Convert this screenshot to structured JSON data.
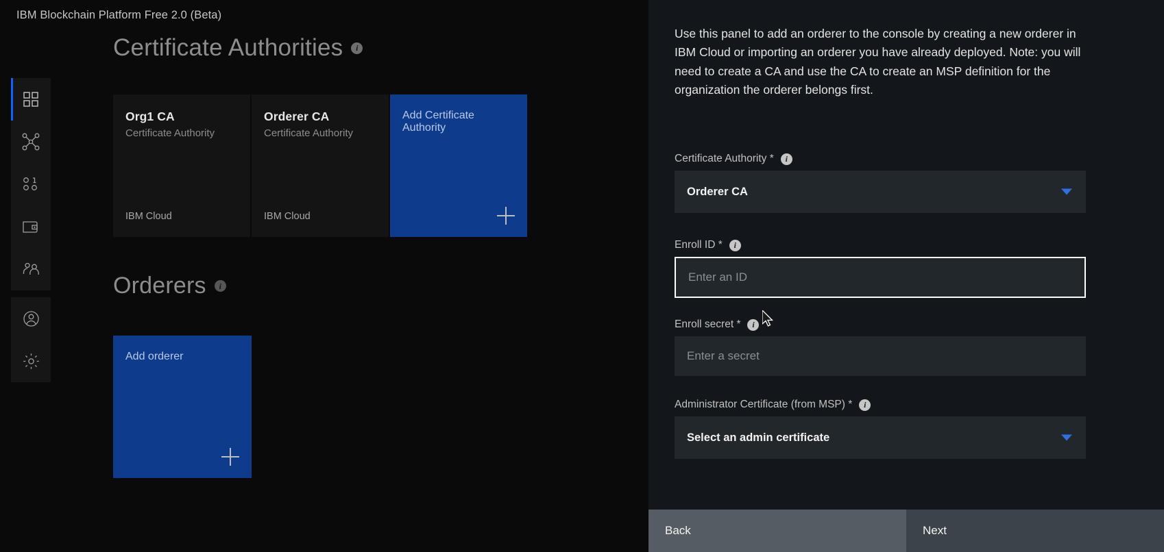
{
  "app": {
    "product_title": "IBM Blockchain Platform Free 2.0 (Beta)"
  },
  "sidebar": {
    "items": [
      {
        "icon": "dashboard-icon",
        "name": "sidebar-item-dashboard",
        "active": true
      },
      {
        "icon": "nodes-icon",
        "name": "sidebar-item-nodes",
        "active": false
      },
      {
        "icon": "channels-icon",
        "name": "sidebar-item-channels",
        "active": false
      },
      {
        "icon": "wallet-icon",
        "name": "sidebar-item-wallet",
        "active": false
      },
      {
        "icon": "organizations-icon",
        "name": "sidebar-item-organizations",
        "active": false
      },
      {
        "icon": "user-avatar-icon",
        "name": "sidebar-item-account",
        "active": false
      },
      {
        "icon": "settings-gear-icon",
        "name": "sidebar-item-settings",
        "active": false
      }
    ]
  },
  "main": {
    "certificate_authorities": {
      "title": "Certificate Authorities",
      "info_icon": "info-icon",
      "cards": [
        {
          "name": "Org1 CA",
          "type": "Certificate Authority",
          "location": "IBM Cloud"
        },
        {
          "name": "Orderer CA",
          "type": "Certificate Authority",
          "location": "IBM Cloud"
        }
      ],
      "add_card": {
        "label": "Add Certificate Authority",
        "icon": "plus-icon"
      }
    },
    "orderers": {
      "title": "Orderers",
      "info_icon": "info-icon",
      "add_card": {
        "label": "Add orderer",
        "icon": "plus-icon"
      }
    }
  },
  "panel": {
    "description": "Use this panel to add an orderer to the console by creating a new orderer in IBM Cloud or importing an orderer you have already deployed. Note: you will need to create a CA and use the CA to create an MSP definition for the organization the orderer belongs first.",
    "fields": [
      {
        "label": "Certificate Authority *",
        "type": "select",
        "value": "Orderer CA",
        "info_icon": "info-icon",
        "chevron": "chevron-down-icon"
      },
      {
        "label": "Enroll ID *",
        "type": "text",
        "value": "",
        "placeholder": "Enter an ID",
        "info_icon": "info-icon",
        "focused": true
      },
      {
        "label": "Enroll secret *",
        "type": "text",
        "value": "",
        "placeholder": "Enter a secret",
        "info_icon": "info-icon",
        "focused": false
      },
      {
        "label": "Administrator Certificate (from MSP) *",
        "type": "select",
        "value": "Select an admin certificate",
        "info_icon": "info-icon",
        "chevron": "chevron-down-icon"
      }
    ],
    "footer": {
      "back_label": "Back",
      "next_label": "Next"
    }
  },
  "colors": {
    "accent_blue": "#0f62fe",
    "card_blue": "#0f3b8c",
    "chevron_blue": "#2f6fe0",
    "panel_bg": "#13161a",
    "page_bg": "#0a0a0b"
  }
}
